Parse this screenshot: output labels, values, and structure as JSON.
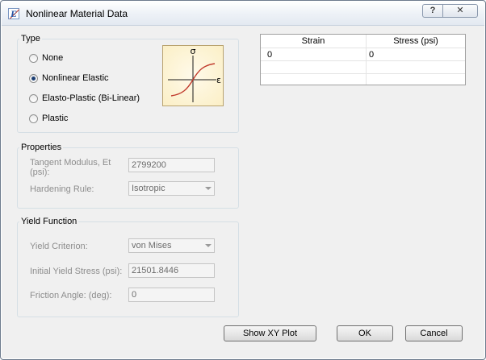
{
  "window": {
    "title": "Nonlinear Material Data",
    "help_label": "?",
    "close_label": "✕"
  },
  "type_group": {
    "title": "Type",
    "options": [
      {
        "label": "None",
        "checked": false
      },
      {
        "label": "Nonlinear Elastic",
        "checked": true
      },
      {
        "label": "Elasto-Plastic (Bi-Linear)",
        "checked": false
      },
      {
        "label": "Plastic",
        "checked": false
      }
    ],
    "graph": {
      "y_axis_label": "σ",
      "x_axis_label": "ε"
    }
  },
  "properties": {
    "title": "Properties",
    "tangent_modulus_label_1": "Tangent Modulus, Et",
    "tangent_modulus_label_2": "(psi):",
    "tangent_modulus_value": "2799200",
    "hardening_rule_label": "Hardening Rule:",
    "hardening_rule_value": "Isotropic"
  },
  "yield_function": {
    "title": "Yield Function",
    "criterion_label": "Yield Criterion:",
    "criterion_value": "von Mises",
    "initial_stress_label": "Initial Yield Stress (psi):",
    "initial_stress_value": "21501.8446",
    "friction_angle_label": "Friction Angle: (deg):",
    "friction_angle_value": "0"
  },
  "table": {
    "columns": [
      "Strain",
      "Stress (psi)"
    ],
    "rows": [
      [
        "0",
        "0"
      ]
    ]
  },
  "buttons": {
    "show_xy_plot": "Show XY Plot",
    "ok": "OK",
    "cancel": "Cancel"
  }
}
